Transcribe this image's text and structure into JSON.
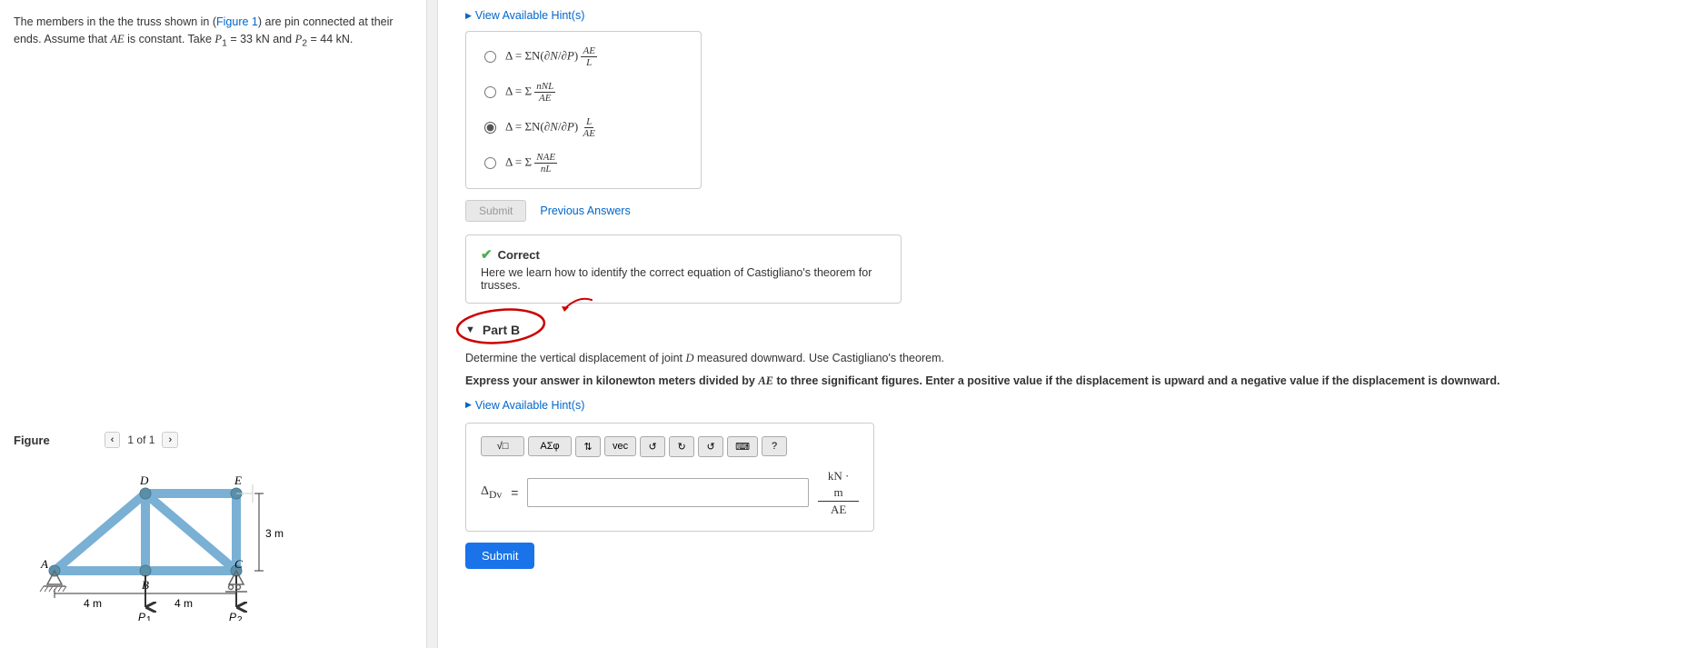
{
  "problem": {
    "description_part1": "The members in the the truss shown in (",
    "figure_link": "Figure 1",
    "description_part2": ") are pin connected at their ends. Assume that ",
    "ae_label": "AE",
    "description_part3": " is constant. Take ",
    "p1_label": "P₁ = 33 kN",
    "description_part4": " and ",
    "p2_label": "P₂ = 44 kN",
    "description_part5": ".",
    "figure_label": "Figure",
    "figure_page": "1 of 1"
  },
  "hint_a": {
    "label": "View Available Hint(s)"
  },
  "options": {
    "items": [
      {
        "id": "opt1",
        "label": "Δ = ΣN(∂N/∂P) AE/L",
        "selected": false
      },
      {
        "id": "opt2",
        "label": "Δ = Σ nNL/AE",
        "selected": false
      },
      {
        "id": "opt3",
        "label": "Δ = ΣN(∂N/∂P) L/AE",
        "selected": true
      },
      {
        "id": "opt4",
        "label": "Δ = Σ NAE/nL",
        "selected": false
      }
    ]
  },
  "part_a": {
    "submit_label": "Submit",
    "prev_answers_label": "Previous Answers",
    "correct_header": "Correct",
    "correct_text": "Here we learn how to identify the correct equation of Castigliano's theorem for trusses."
  },
  "part_b": {
    "label": "Part B",
    "arrow_label": "▼",
    "question": "Determine the vertical displacement of joint D measured downward. Use Castigliano's theorem.",
    "express": "Express your answer in kilonewton meters divided by AE to three significant figures. Enter a positive value if the displacement is upward and a negative value if the displacement is downward.",
    "hint_label": "View Available Hint(s)",
    "delta_label": "Δ",
    "subscript": "Dv",
    "equals": "=",
    "units_num": "kN · m",
    "units_den": "AE",
    "submit_label": "Submit"
  },
  "toolbar": {
    "btn1": "√□",
    "btn2": "ΑΣφ",
    "btn3": "↕",
    "btn4": "vec",
    "btn5": "↺",
    "btn6": "↻",
    "btn7": "↺",
    "btn8": "⌨",
    "btn9": "?"
  }
}
